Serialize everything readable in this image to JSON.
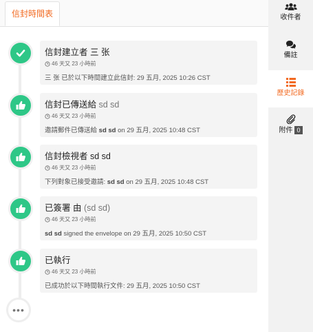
{
  "tabs": {
    "active_label": "信封時間表"
  },
  "entries": [
    {
      "title_main": "信封建立者 三 张",
      "title_muted": "",
      "time": "46 天又 23 小時前",
      "desc_prefix": "三 张 已於以下時間建立此信封: 29 五月, 2025 10:26 CST",
      "desc_bold": "",
      "desc_suffix": "",
      "icon": "check-icon"
    },
    {
      "title_main": "信封已傳送給",
      "title_muted": "sd sd",
      "time": "46 天又 23 小時前",
      "desc_prefix": "邀請郵件已傳送給",
      "desc_bold": "sd sd",
      "desc_suffix": "on 29 五月, 2025 10:48 CST",
      "icon": "thumbs-up-icon"
    },
    {
      "title_main": "信封檢視者 sd sd",
      "title_muted": "",
      "time": "46 天又 23 小時前",
      "desc_prefix": "下列對象已接受邀請:",
      "desc_bold": "sd sd",
      "desc_suffix": "on 29 五月, 2025 10:48 CST",
      "icon": "thumbs-up-icon"
    },
    {
      "title_main": "已簽署 由",
      "title_muted": "(sd sd)",
      "time": "46 天又 23 小時前",
      "desc_prefix": "",
      "desc_bold": "sd sd",
      "desc_suffix": "signed the envelope on 29 五月, 2025 10:50 CST",
      "icon": "thumbs-up-icon"
    },
    {
      "title_main": "已執行",
      "title_muted": "",
      "time": "46 天又 23 小時前",
      "desc_prefix": "已成功於以下時間執行文件: 29 五月, 2025 10:50 CST",
      "desc_bold": "",
      "desc_suffix": "",
      "icon": "thumbs-up-icon"
    }
  ],
  "more": {
    "label": "•••"
  },
  "sidebar": {
    "recipients": "收件者",
    "notes": "備註",
    "history": "歷史記錄",
    "attachments": "附件",
    "attachments_count": "0"
  },
  "colors": {
    "accent": "#f26a21",
    "success": "#2ec787"
  }
}
